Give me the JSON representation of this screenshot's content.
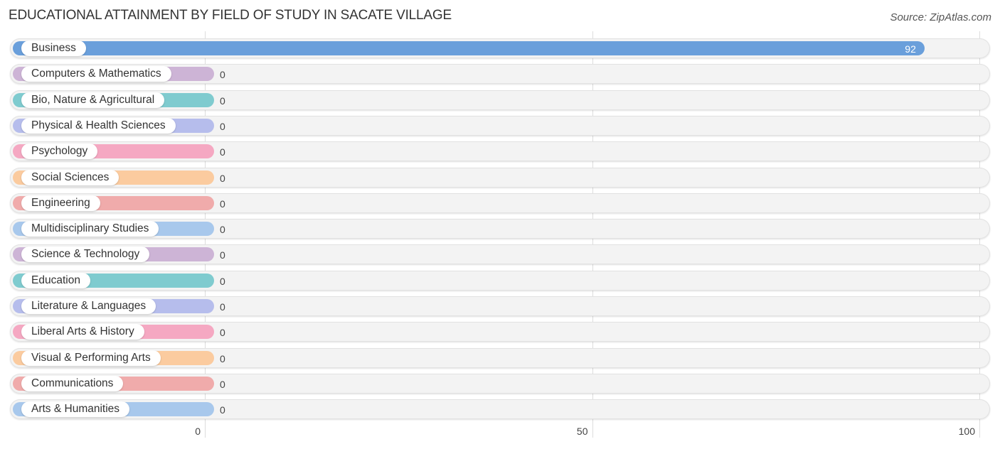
{
  "chart_data": {
    "type": "bar",
    "orientation": "horizontal",
    "title": "EDUCATIONAL ATTAINMENT BY FIELD OF STUDY IN SACATE VILLAGE",
    "source": "Source: ZipAtlas.com",
    "xlabel": "",
    "ylabel": "",
    "xlim": [
      0,
      100
    ],
    "ticks": [
      0,
      50,
      100
    ],
    "grid": true,
    "categories": [
      "Business",
      "Computers & Mathematics",
      "Bio, Nature & Agricultural",
      "Physical & Health Sciences",
      "Psychology",
      "Social Sciences",
      "Engineering",
      "Multidisciplinary Studies",
      "Science & Technology",
      "Education",
      "Literature & Languages",
      "Liberal Arts & History",
      "Visual & Performing Arts",
      "Communications",
      "Arts & Humanities"
    ],
    "values": [
      92,
      0,
      0,
      0,
      0,
      0,
      0,
      0,
      0,
      0,
      0,
      0,
      0,
      0,
      0
    ],
    "colors": [
      "#6a9fdb",
      "#cdb4d6",
      "#7fcbcf",
      "#b6bdec",
      "#f5a8c2",
      "#fbcb9f",
      "#f0abab",
      "#a8c8ec",
      "#cdb4d6",
      "#7fcbcf",
      "#b6bdec",
      "#f5a8c2",
      "#fbcb9f",
      "#f0abab",
      "#a8c8ec"
    ]
  }
}
